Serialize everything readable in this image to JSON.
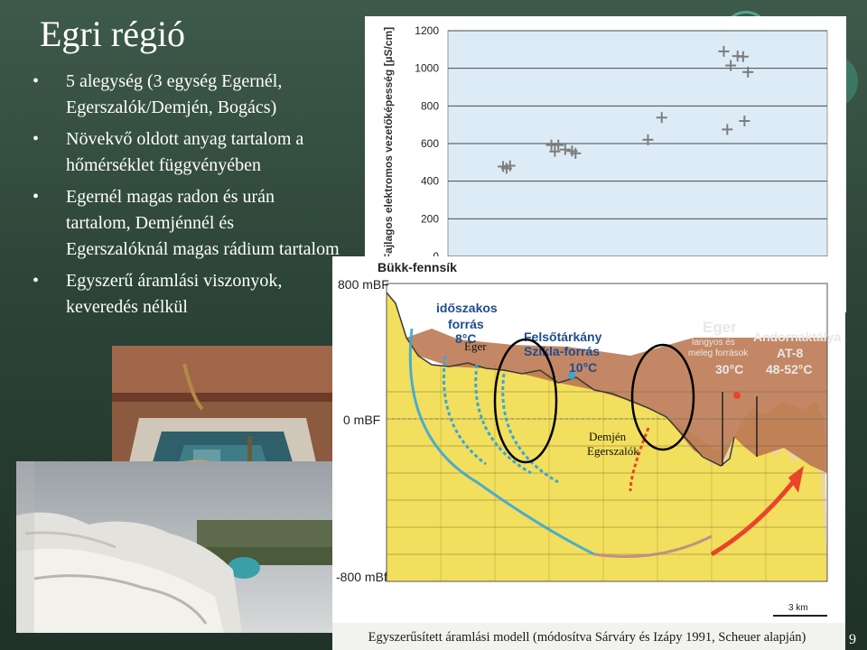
{
  "slide": {
    "title": "Egri régió",
    "bullets": [
      "5 alegység (3 egység Egernél, Egerszalók/Demjén, Bogács)",
      "Növekvő oldott anyag tartalom a hőmérséklet függvényében",
      "Egernél magas radon és urán tartalom, Demjénnél és Egerszalóknál magas rádium tartalom",
      "Egyszerű áramlási viszonyok, keveredés nélkül"
    ],
    "bullet_symbol": "•",
    "caption": "Egyszerűsített áramlási modell (módosítva Sárváry és Izápy 1991, Scheuer alapján)",
    "slide_number": "9"
  },
  "section": {
    "region_label": "Bükk-fennsík",
    "elev_top": "800 mBF",
    "elev_zero": "0 mBF",
    "elev_bottom": "-800 mBf",
    "spring_intermittent": [
      "időszakos",
      "forrás",
      "8°C"
    ],
    "spring_felsotarkany": [
      "Felsőtárkány",
      "Szikla-forrás",
      "10°C"
    ],
    "eger_title": "Eger",
    "eger_sub": [
      "langyos és",
      "meleg források"
    ],
    "eger_temp": "30°C",
    "well_name": [
      "Andornaktálya",
      "AT-8",
      "48-52°C"
    ],
    "overlay_eger": "Eger",
    "overlay_demjen": [
      "Demjén",
      "Egerszalók"
    ],
    "scale": "3 km",
    "colors": {
      "limestone": "#f2df5a",
      "cover": "#b9724a",
      "cold_flow": "#39a7d8",
      "warm_flow": "#e8452c"
    }
  },
  "chart_data": {
    "type": "scatter",
    "ylabel": "Fajlagos elektromos vezetőképesség [µS/cm]",
    "ylim": [
      0,
      1200
    ],
    "yticks": [
      0,
      200,
      400,
      600,
      800,
      1000,
      1200
    ],
    "xlim": [
      0,
      55
    ],
    "grid": true,
    "marker": "+",
    "marker_color": "#7d7d7d",
    "plot_background": "#dcebf5",
    "points": [
      [
        8,
        478
      ],
      [
        8.5,
        468
      ],
      [
        9,
        482
      ],
      [
        15,
        592
      ],
      [
        15.5,
        558
      ],
      [
        16,
        592
      ],
      [
        17,
        568
      ],
      [
        18,
        560
      ],
      [
        18.5,
        548
      ],
      [
        29,
        620
      ],
      [
        31,
        738
      ],
      [
        40,
        1090
      ],
      [
        40.5,
        675
      ],
      [
        41,
        1015
      ],
      [
        42,
        1065
      ],
      [
        42.8,
        1062
      ],
      [
        43,
        720
      ],
      [
        43.5,
        980
      ]
    ]
  }
}
